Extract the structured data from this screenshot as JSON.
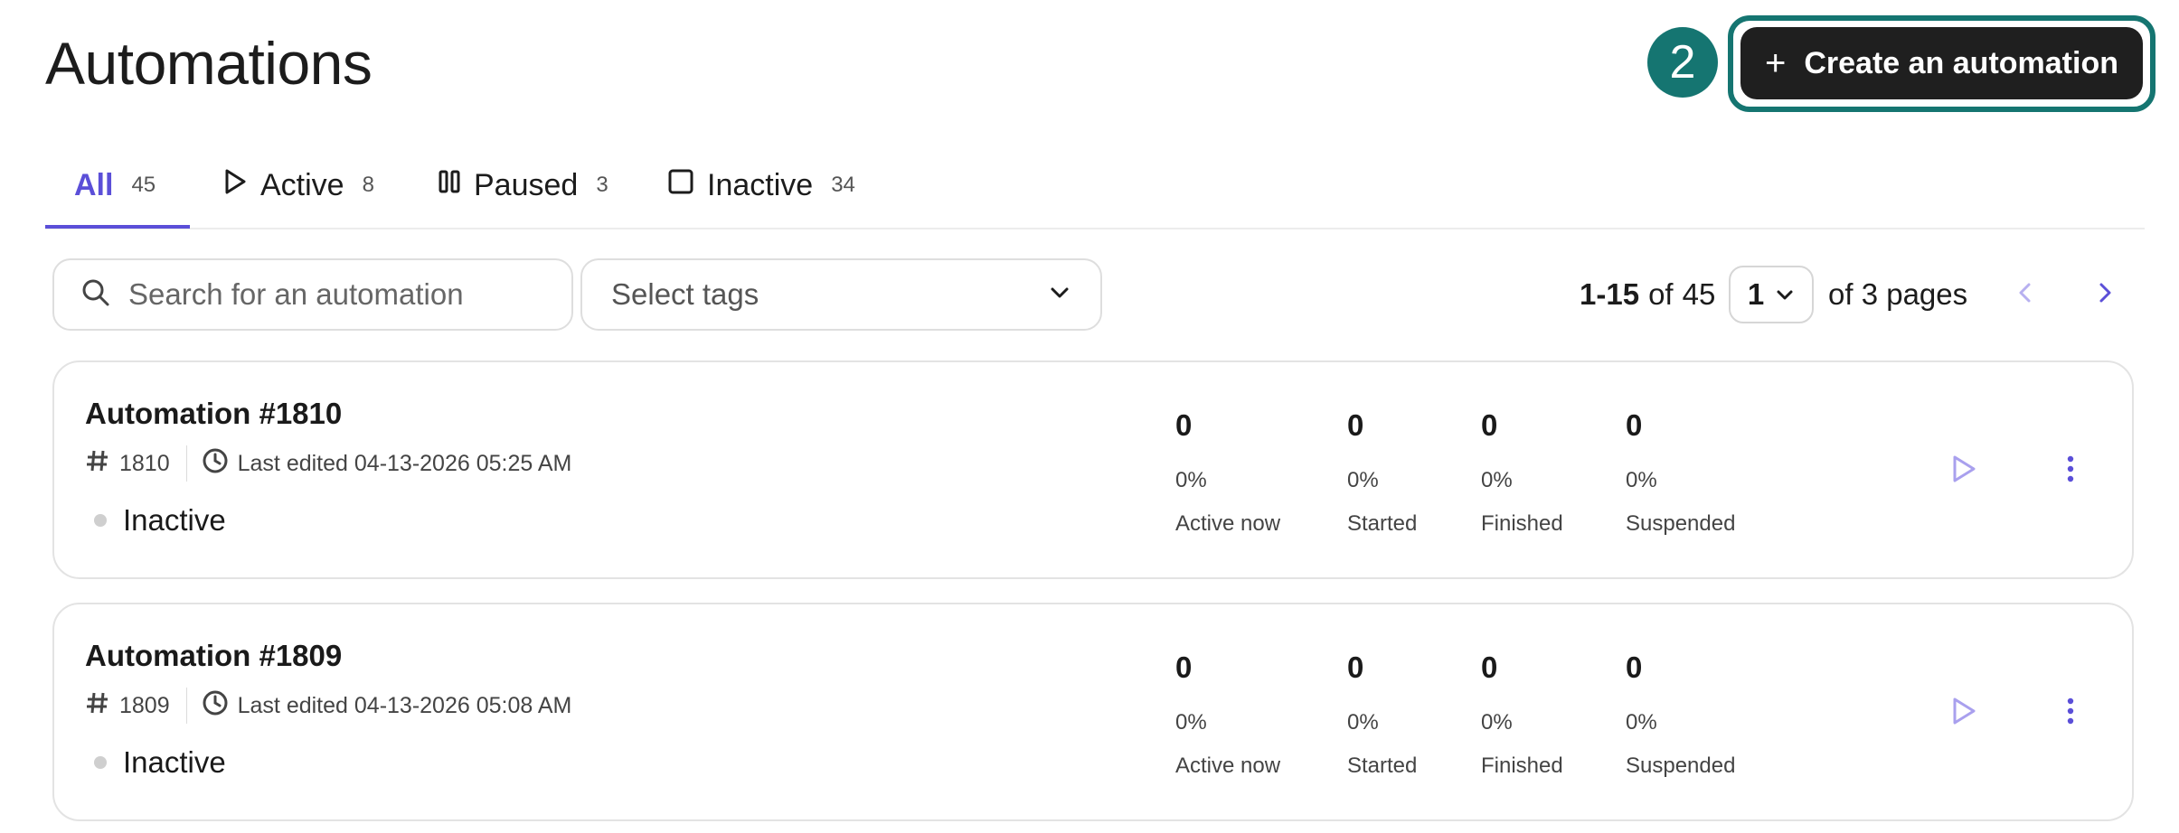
{
  "header": {
    "title": "Automations",
    "step_number": "2",
    "create_label": "Create an automation"
  },
  "tabs": [
    {
      "label": "All",
      "count": "45",
      "icon": "none",
      "active": true
    },
    {
      "label": "Active",
      "count": "8",
      "icon": "play-icon"
    },
    {
      "label": "Paused",
      "count": "3",
      "icon": "pause-icon"
    },
    {
      "label": "Inactive",
      "count": "34",
      "icon": "square-icon"
    }
  ],
  "search": {
    "placeholder": "Search for an automation",
    "value": ""
  },
  "tags": {
    "placeholder": "Select tags"
  },
  "pagination": {
    "range": "1-15",
    "of_label": "of",
    "total": "45",
    "current_page": "1",
    "pages_label": "of 3 pages"
  },
  "automations": [
    {
      "title": "Automation #1810",
      "id": "1810",
      "last_edited": "Last edited 04-13-2026 05:25 AM",
      "status": "Inactive",
      "metrics": [
        {
          "value": "0",
          "percent": "0%",
          "label": "Active now"
        },
        {
          "value": "0",
          "percent": "0%",
          "label": "Started"
        },
        {
          "value": "0",
          "percent": "0%",
          "label": "Finished"
        },
        {
          "value": "0",
          "percent": "0%",
          "label": "Suspended"
        }
      ]
    },
    {
      "title": "Automation #1809",
      "id": "1809",
      "last_edited": "Last edited 04-13-2026 05:08 AM",
      "status": "Inactive",
      "metrics": [
        {
          "value": "0",
          "percent": "0%",
          "label": "Active now"
        },
        {
          "value": "0",
          "percent": "0%",
          "label": "Started"
        },
        {
          "value": "0",
          "percent": "0%",
          "label": "Finished"
        },
        {
          "value": "0",
          "percent": "0%",
          "label": "Suspended"
        }
      ]
    }
  ],
  "colors": {
    "accent": "#5b4fd8",
    "highlight": "#157571",
    "primary_button": "#1f1f1f",
    "play_icon": "#a9a0ee"
  }
}
